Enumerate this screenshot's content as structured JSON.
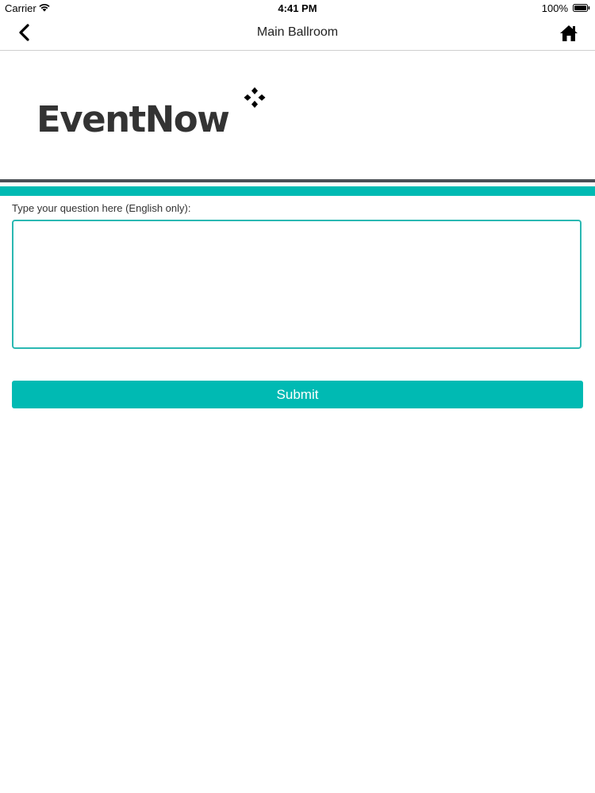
{
  "status_bar": {
    "carrier": "Carrier",
    "time": "4:41 PM",
    "battery": "100%"
  },
  "nav": {
    "title": "Main Ballroom",
    "back_icon": "chevron-left-icon",
    "home_icon": "home-icon"
  },
  "logo": {
    "text": "EventNow"
  },
  "form": {
    "question_label": "Type your question here (English only):",
    "question_value": "",
    "question_placeholder": "",
    "submit_label": "Submit"
  },
  "colors": {
    "accent": "#00bab3",
    "divider": "#4a4f55",
    "logo_text": "#333333"
  }
}
